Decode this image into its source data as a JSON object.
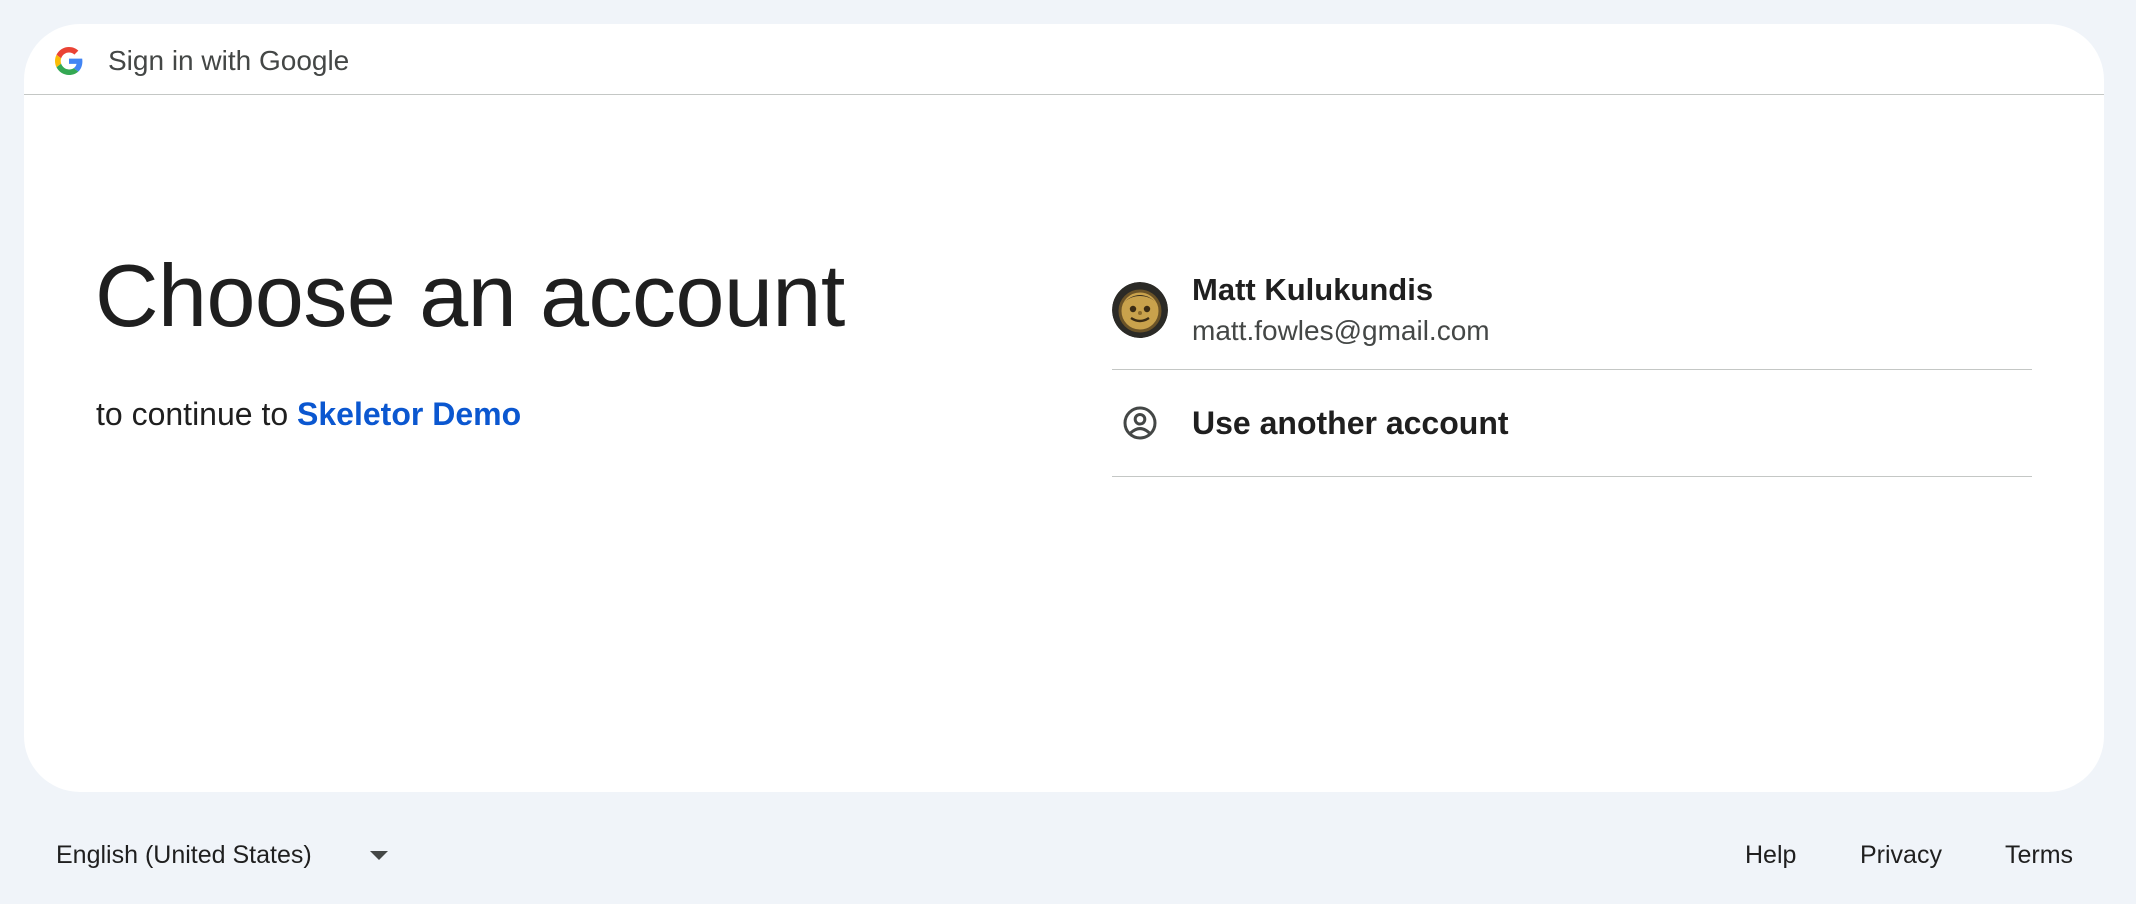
{
  "header": {
    "title": "Sign in with Google",
    "logo_icon": "google-g-icon"
  },
  "main": {
    "heading": "Choose an account",
    "subtitle_prefix": "to continue to",
    "app_name": "Skeletor Demo"
  },
  "accounts": [
    {
      "name": "Matt Kulukundis",
      "email": "matt.fowles@gmail.com",
      "avatar_icon": "user-avatar"
    }
  ],
  "other_account": {
    "label": "Use another account",
    "icon": "account-circle-icon"
  },
  "footer": {
    "language": "English (United States)",
    "links": [
      "Help",
      "Privacy",
      "Terms"
    ]
  },
  "colors": {
    "page_background": "#f0f4f9",
    "card_background": "#ffffff",
    "link_blue": "#0b57d0",
    "divider": "#c4c7c5",
    "text_primary": "#1f1f1f",
    "text_secondary": "#444746"
  }
}
